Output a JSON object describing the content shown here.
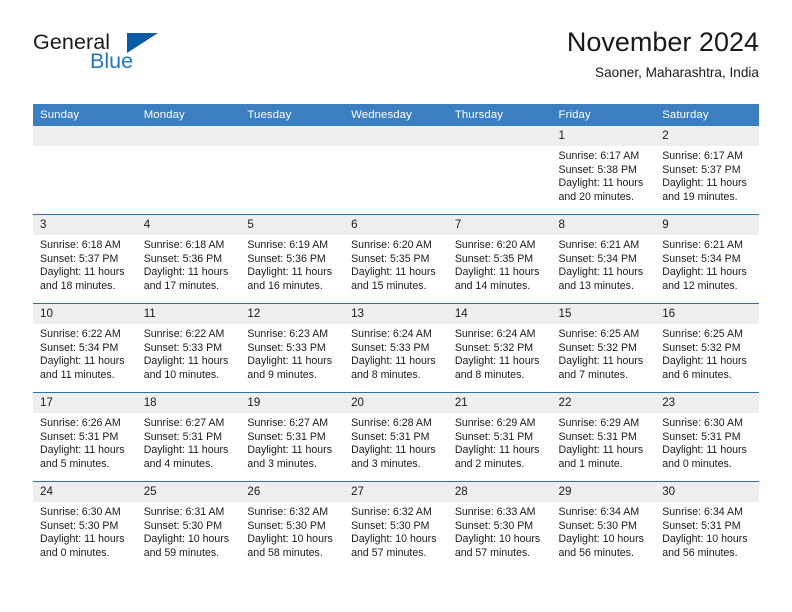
{
  "brand": {
    "name_part1": "General",
    "name_part2": "Blue",
    "logo_icon": "triangle-logo-icon",
    "accent_color": "#2076c4",
    "triangle_color": "#0a5ca8"
  },
  "header": {
    "month_title": "November 2024",
    "location": "Saoner, Maharashtra, India"
  },
  "theme": {
    "header_bar_color": "#3c7fc1",
    "daynum_band_color": "#eeeeee",
    "row_divider_color": "#2f6fae"
  },
  "weekday_headers": [
    "Sunday",
    "Monday",
    "Tuesday",
    "Wednesday",
    "Thursday",
    "Friday",
    "Saturday"
  ],
  "weeks": [
    [
      {
        "day": "",
        "empty": true,
        "sunrise": "",
        "sunset": "",
        "daylight_line1": "",
        "daylight_line2": ""
      },
      {
        "day": "",
        "empty": true,
        "sunrise": "",
        "sunset": "",
        "daylight_line1": "",
        "daylight_line2": ""
      },
      {
        "day": "",
        "empty": true,
        "sunrise": "",
        "sunset": "",
        "daylight_line1": "",
        "daylight_line2": ""
      },
      {
        "day": "",
        "empty": true,
        "sunrise": "",
        "sunset": "",
        "daylight_line1": "",
        "daylight_line2": ""
      },
      {
        "day": "",
        "empty": true,
        "sunrise": "",
        "sunset": "",
        "daylight_line1": "",
        "daylight_line2": ""
      },
      {
        "day": "1",
        "empty": false,
        "sunrise": "Sunrise: 6:17 AM",
        "sunset": "Sunset: 5:38 PM",
        "daylight_line1": "Daylight: 11 hours",
        "daylight_line2": "and 20 minutes."
      },
      {
        "day": "2",
        "empty": false,
        "sunrise": "Sunrise: 6:17 AM",
        "sunset": "Sunset: 5:37 PM",
        "daylight_line1": "Daylight: 11 hours",
        "daylight_line2": "and 19 minutes."
      }
    ],
    [
      {
        "day": "3",
        "empty": false,
        "sunrise": "Sunrise: 6:18 AM",
        "sunset": "Sunset: 5:37 PM",
        "daylight_line1": "Daylight: 11 hours",
        "daylight_line2": "and 18 minutes."
      },
      {
        "day": "4",
        "empty": false,
        "sunrise": "Sunrise: 6:18 AM",
        "sunset": "Sunset: 5:36 PM",
        "daylight_line1": "Daylight: 11 hours",
        "daylight_line2": "and 17 minutes."
      },
      {
        "day": "5",
        "empty": false,
        "sunrise": "Sunrise: 6:19 AM",
        "sunset": "Sunset: 5:36 PM",
        "daylight_line1": "Daylight: 11 hours",
        "daylight_line2": "and 16 minutes."
      },
      {
        "day": "6",
        "empty": false,
        "sunrise": "Sunrise: 6:20 AM",
        "sunset": "Sunset: 5:35 PM",
        "daylight_line1": "Daylight: 11 hours",
        "daylight_line2": "and 15 minutes."
      },
      {
        "day": "7",
        "empty": false,
        "sunrise": "Sunrise: 6:20 AM",
        "sunset": "Sunset: 5:35 PM",
        "daylight_line1": "Daylight: 11 hours",
        "daylight_line2": "and 14 minutes."
      },
      {
        "day": "8",
        "empty": false,
        "sunrise": "Sunrise: 6:21 AM",
        "sunset": "Sunset: 5:34 PM",
        "daylight_line1": "Daylight: 11 hours",
        "daylight_line2": "and 13 minutes."
      },
      {
        "day": "9",
        "empty": false,
        "sunrise": "Sunrise: 6:21 AM",
        "sunset": "Sunset: 5:34 PM",
        "daylight_line1": "Daylight: 11 hours",
        "daylight_line2": "and 12 minutes."
      }
    ],
    [
      {
        "day": "10",
        "empty": false,
        "sunrise": "Sunrise: 6:22 AM",
        "sunset": "Sunset: 5:34 PM",
        "daylight_line1": "Daylight: 11 hours",
        "daylight_line2": "and 11 minutes."
      },
      {
        "day": "11",
        "empty": false,
        "sunrise": "Sunrise: 6:22 AM",
        "sunset": "Sunset: 5:33 PM",
        "daylight_line1": "Daylight: 11 hours",
        "daylight_line2": "and 10 minutes."
      },
      {
        "day": "12",
        "empty": false,
        "sunrise": "Sunrise: 6:23 AM",
        "sunset": "Sunset: 5:33 PM",
        "daylight_line1": "Daylight: 11 hours",
        "daylight_line2": "and 9 minutes."
      },
      {
        "day": "13",
        "empty": false,
        "sunrise": "Sunrise: 6:24 AM",
        "sunset": "Sunset: 5:33 PM",
        "daylight_line1": "Daylight: 11 hours",
        "daylight_line2": "and 8 minutes."
      },
      {
        "day": "14",
        "empty": false,
        "sunrise": "Sunrise: 6:24 AM",
        "sunset": "Sunset: 5:32 PM",
        "daylight_line1": "Daylight: 11 hours",
        "daylight_line2": "and 8 minutes."
      },
      {
        "day": "15",
        "empty": false,
        "sunrise": "Sunrise: 6:25 AM",
        "sunset": "Sunset: 5:32 PM",
        "daylight_line1": "Daylight: 11 hours",
        "daylight_line2": "and 7 minutes."
      },
      {
        "day": "16",
        "empty": false,
        "sunrise": "Sunrise: 6:25 AM",
        "sunset": "Sunset: 5:32 PM",
        "daylight_line1": "Daylight: 11 hours",
        "daylight_line2": "and 6 minutes."
      }
    ],
    [
      {
        "day": "17",
        "empty": false,
        "sunrise": "Sunrise: 6:26 AM",
        "sunset": "Sunset: 5:31 PM",
        "daylight_line1": "Daylight: 11 hours",
        "daylight_line2": "and 5 minutes."
      },
      {
        "day": "18",
        "empty": false,
        "sunrise": "Sunrise: 6:27 AM",
        "sunset": "Sunset: 5:31 PM",
        "daylight_line1": "Daylight: 11 hours",
        "daylight_line2": "and 4 minutes."
      },
      {
        "day": "19",
        "empty": false,
        "sunrise": "Sunrise: 6:27 AM",
        "sunset": "Sunset: 5:31 PM",
        "daylight_line1": "Daylight: 11 hours",
        "daylight_line2": "and 3 minutes."
      },
      {
        "day": "20",
        "empty": false,
        "sunrise": "Sunrise: 6:28 AM",
        "sunset": "Sunset: 5:31 PM",
        "daylight_line1": "Daylight: 11 hours",
        "daylight_line2": "and 3 minutes."
      },
      {
        "day": "21",
        "empty": false,
        "sunrise": "Sunrise: 6:29 AM",
        "sunset": "Sunset: 5:31 PM",
        "daylight_line1": "Daylight: 11 hours",
        "daylight_line2": "and 2 minutes."
      },
      {
        "day": "22",
        "empty": false,
        "sunrise": "Sunrise: 6:29 AM",
        "sunset": "Sunset: 5:31 PM",
        "daylight_line1": "Daylight: 11 hours",
        "daylight_line2": "and 1 minute."
      },
      {
        "day": "23",
        "empty": false,
        "sunrise": "Sunrise: 6:30 AM",
        "sunset": "Sunset: 5:31 PM",
        "daylight_line1": "Daylight: 11 hours",
        "daylight_line2": "and 0 minutes."
      }
    ],
    [
      {
        "day": "24",
        "empty": false,
        "sunrise": "Sunrise: 6:30 AM",
        "sunset": "Sunset: 5:30 PM",
        "daylight_line1": "Daylight: 11 hours",
        "daylight_line2": "and 0 minutes."
      },
      {
        "day": "25",
        "empty": false,
        "sunrise": "Sunrise: 6:31 AM",
        "sunset": "Sunset: 5:30 PM",
        "daylight_line1": "Daylight: 10 hours",
        "daylight_line2": "and 59 minutes."
      },
      {
        "day": "26",
        "empty": false,
        "sunrise": "Sunrise: 6:32 AM",
        "sunset": "Sunset: 5:30 PM",
        "daylight_line1": "Daylight: 10 hours",
        "daylight_line2": "and 58 minutes."
      },
      {
        "day": "27",
        "empty": false,
        "sunrise": "Sunrise: 6:32 AM",
        "sunset": "Sunset: 5:30 PM",
        "daylight_line1": "Daylight: 10 hours",
        "daylight_line2": "and 57 minutes."
      },
      {
        "day": "28",
        "empty": false,
        "sunrise": "Sunrise: 6:33 AM",
        "sunset": "Sunset: 5:30 PM",
        "daylight_line1": "Daylight: 10 hours",
        "daylight_line2": "and 57 minutes."
      },
      {
        "day": "29",
        "empty": false,
        "sunrise": "Sunrise: 6:34 AM",
        "sunset": "Sunset: 5:30 PM",
        "daylight_line1": "Daylight: 10 hours",
        "daylight_line2": "and 56 minutes."
      },
      {
        "day": "30",
        "empty": false,
        "sunrise": "Sunrise: 6:34 AM",
        "sunset": "Sunset: 5:31 PM",
        "daylight_line1": "Daylight: 10 hours",
        "daylight_line2": "and 56 minutes."
      }
    ]
  ]
}
